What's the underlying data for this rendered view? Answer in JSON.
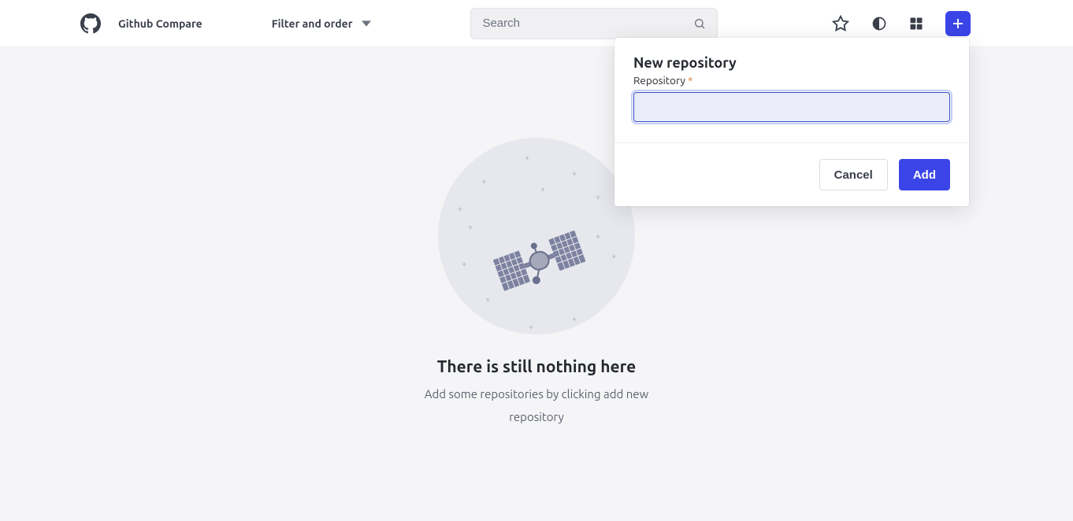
{
  "header": {
    "brand_title": "Github Compare",
    "filter_label": "Filter and order",
    "search_placeholder": "Search"
  },
  "empty_state": {
    "title": "There is still nothing here",
    "subtitle": "Add some repositories by clicking add new repository"
  },
  "modal": {
    "title": "New repository",
    "field_label": "Repository",
    "required_mark": "*",
    "input_value": "",
    "cancel_label": "Cancel",
    "add_label": "Add"
  }
}
